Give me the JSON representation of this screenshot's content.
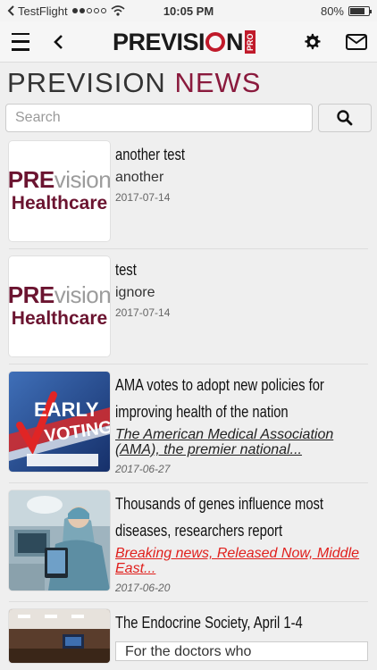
{
  "status_bar": {
    "carrier": "TestFlight",
    "time": "10:05 PM",
    "battery": "80%",
    "battery_level": 0.8
  },
  "header": {
    "logo_text": "PREVISION",
    "logo_badge": "PRO"
  },
  "page": {
    "title_part1": "PREVISION",
    "title_part2": "NEWS"
  },
  "search": {
    "placeholder": "Search",
    "value": ""
  },
  "news": [
    {
      "title": "another test",
      "subtitle": "another",
      "date": "2017-07-14",
      "thumb": {
        "line1a": "PRE",
        "line1b": "vision",
        "line2": "Healthcare"
      }
    },
    {
      "title": "test",
      "subtitle": "ignore",
      "date": "2017-07-14",
      "thumb": {
        "line1a": "PRE",
        "line1b": "vision",
        "line2": "Healthcare"
      }
    },
    {
      "title": "AMA votes to adopt new policies for improving health of the nation",
      "link": "The American Medical Association (AMA), the premier national...",
      "date": "2017-06-27",
      "thumb": {
        "text1": "EARLY",
        "text2": "VOTING"
      }
    },
    {
      "title": "Thousands of genes influence most diseases, researchers report",
      "link": "Breaking news, Released Now, Middle East...",
      "date": "2017-06-20"
    },
    {
      "title": "The Endocrine Society, April 1-4",
      "preview": "For the doctors who"
    }
  ],
  "colors": {
    "brand": "#8a1a3d",
    "accent_red": "#c01a2a",
    "link_red": "#e0201d"
  }
}
